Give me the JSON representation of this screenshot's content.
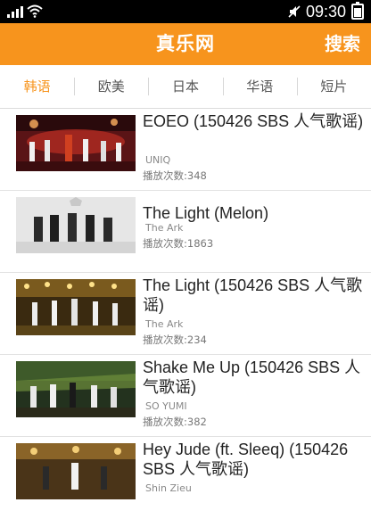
{
  "status_bar": {
    "time": "09:30"
  },
  "header": {
    "title": "真乐网",
    "search_label": "搜索"
  },
  "tabs": [
    {
      "label": "韩语",
      "active": true
    },
    {
      "label": "欧美",
      "active": false
    },
    {
      "label": "日本",
      "active": false
    },
    {
      "label": "华语",
      "active": false
    },
    {
      "label": "短片",
      "active": false
    }
  ],
  "videos": [
    {
      "title": "EOEO (150426 SBS 人气歌谣)",
      "artist": "UNIQ",
      "plays": "播放次数:348"
    },
    {
      "title": "The Light (Melon)",
      "artist": "The Ark",
      "plays": "播放次数:1863"
    },
    {
      "title": "The Light (150426 SBS 人气歌谣)",
      "artist": "The Ark",
      "plays": "播放次数:234"
    },
    {
      "title": "Shake Me Up (150426 SBS 人气歌谣)",
      "artist": "SO YUMI",
      "plays": "播放次数:382"
    },
    {
      "title": "Hey Jude (ft. Sleeq) (150426 SBS 人气歌谣)",
      "artist": "Shin Ziеu",
      "plays": ""
    }
  ],
  "colors": {
    "accent": "#f7941d",
    "status_bar": "#000000"
  }
}
